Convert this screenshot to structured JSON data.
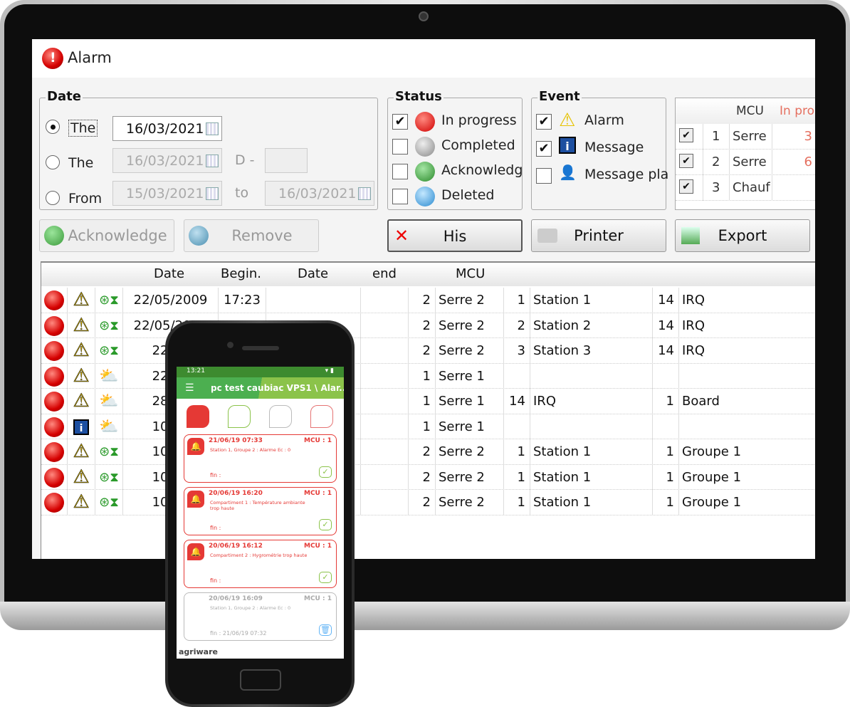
{
  "window": {
    "title": "Alarm"
  },
  "date_group": {
    "legend": "Date",
    "options": [
      {
        "label": "The",
        "selected": true,
        "value": "16/03/2021"
      },
      {
        "label": "The",
        "selected": false,
        "value": "16/03/2021",
        "d_label": "D -",
        "d_value": ""
      },
      {
        "label": "From",
        "selected": false,
        "value": "15/03/2021",
        "to_label": "to",
        "to_value": "16/03/2021"
      }
    ]
  },
  "status_group": {
    "legend": "Status",
    "items": [
      {
        "label": "In progress",
        "checked": true,
        "color": "#e00000"
      },
      {
        "label": "Completed",
        "checked": false,
        "color": "#9e9e9e"
      },
      {
        "label": "Acknowledg",
        "checked": false,
        "color": "#2e9e2e"
      },
      {
        "label": "Deleted",
        "checked": false,
        "color": "#3aa0e0"
      }
    ]
  },
  "event_group": {
    "legend": "Event",
    "items": [
      {
        "label": "Alarm",
        "checked": true,
        "icon": "warning-icon"
      },
      {
        "label": "Message",
        "checked": true,
        "icon": "info-icon"
      },
      {
        "label": "Message pla",
        "checked": false,
        "icon": "user-message-icon"
      }
    ]
  },
  "mcu_table": {
    "headers": [
      "MCU",
      "In pro"
    ],
    "rows": [
      {
        "checked": true,
        "num": "1",
        "name": "Serre",
        "in_progress": "3"
      },
      {
        "checked": true,
        "num": "2",
        "name": "Serre",
        "in_progress": "6"
      },
      {
        "checked": true,
        "num": "3",
        "name": "Chauf",
        "in_progress": ""
      }
    ]
  },
  "buttons": {
    "acknowledge": "Acknowledge",
    "remove": "Remove",
    "his": "His",
    "printer": "Printer",
    "export": "Export"
  },
  "grid": {
    "headers": [
      "Date",
      "Begin.",
      "Date",
      "end",
      "MCU"
    ],
    "rows": [
      {
        "status": "red",
        "type": "alarm",
        "source": "valve",
        "date": "22/05/2009",
        "begin": "17:23",
        "c1": "2",
        "c2": "Serre 2",
        "c3": "1",
        "c4": "Station 1",
        "c5": "14",
        "c6": "IRQ"
      },
      {
        "status": "red",
        "type": "alarm",
        "source": "valve",
        "date": "22/05/2009",
        "begin": "",
        "c1": "2",
        "c2": "Serre 2",
        "c3": "2",
        "c4": "Station 2",
        "c5": "14",
        "c6": "IRQ"
      },
      {
        "status": "red",
        "type": "alarm",
        "source": "valve",
        "date": "22/05",
        "begin": "",
        "c1": "2",
        "c2": "Serre 2",
        "c3": "3",
        "c4": "Station 3",
        "c5": "14",
        "c6": "IRQ"
      },
      {
        "status": "red",
        "type": "alarm",
        "source": "weather",
        "date": "22/05",
        "begin": "",
        "c1": "1",
        "c2": "Serre 1",
        "c3": "",
        "c4": "",
        "c5": "",
        "c6": ""
      },
      {
        "status": "red",
        "type": "alarm",
        "source": "weather",
        "date": "28/04",
        "begin": "",
        "c1": "1",
        "c2": "Serre 1",
        "c3": "14",
        "c4": "IRQ",
        "c5": "1",
        "c6": "Board"
      },
      {
        "status": "red",
        "type": "info",
        "source": "weather",
        "date": "10/04",
        "begin": "",
        "c1": "1",
        "c2": "Serre 1",
        "c3": "",
        "c4": "",
        "c5": "",
        "c6": ""
      },
      {
        "status": "red",
        "type": "alarm",
        "source": "valve",
        "date": "10/04",
        "begin": "",
        "c1": "2",
        "c2": "Serre 2",
        "c3": "1",
        "c4": "Station 1",
        "c5": "1",
        "c6": "Groupe 1"
      },
      {
        "status": "red",
        "type": "alarm",
        "source": "valve",
        "date": "10/04",
        "begin": "",
        "c1": "2",
        "c2": "Serre 2",
        "c3": "1",
        "c4": "Station 1",
        "c5": "1",
        "c6": "Groupe 1"
      },
      {
        "status": "red",
        "type": "alarm",
        "source": "valve",
        "date": "10/04",
        "begin": "",
        "c1": "2",
        "c2": "Serre 2",
        "c3": "1",
        "c4": "Station 1",
        "c5": "1",
        "c6": "Groupe 1"
      }
    ]
  },
  "phone": {
    "time": "13:21",
    "title": "pc test caubiac VPS1 \\ Alar...",
    "tabs": [
      "alarm-in-progress",
      "alarm-acknowledged",
      "alarm-completed",
      "alarm-all"
    ],
    "cards": [
      {
        "date": "21/06/19  07:33",
        "mcu": "MCU : 1",
        "desc": "Station 1, Groupe 2 : Alarme Ec : 0",
        "fin": "fin :",
        "state": "active"
      },
      {
        "date": "20/06/19  16:20",
        "mcu": "MCU : 1",
        "desc": "Compartiment 1 : Température ambiante trop haute",
        "fin": "fin :",
        "state": "active"
      },
      {
        "date": "20/06/19  16:12",
        "mcu": "MCU : 1",
        "desc": "Compartiment 2 : Hygrométrie trop haute",
        "fin": "fin :",
        "state": "active"
      },
      {
        "date": "20/06/19  16:09",
        "mcu": "MCU : 1",
        "desc": "Station 1, Groupe 2 : Alarme Ec : 0",
        "fin": "fin :   21/06/19  07:32",
        "state": "completed"
      }
    ],
    "brand": "agriware",
    "accent": "#e53935",
    "bar_color": "#4caf50"
  }
}
